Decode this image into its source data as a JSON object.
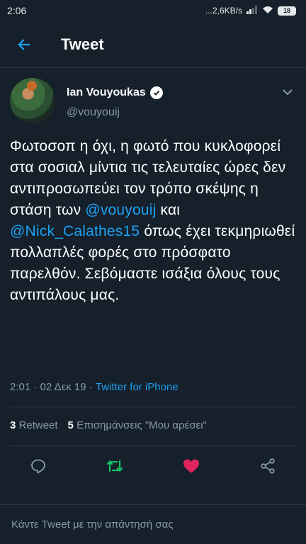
{
  "status_bar": {
    "time": "2:06",
    "network_speed": "...2,6KB/s",
    "battery": "18"
  },
  "header": {
    "title": "Tweet"
  },
  "tweet": {
    "author_name": "Ian Vouyoukas",
    "author_handle": "@vouyouij",
    "text": {
      "p1": "Φωτοσοπ η όχι, η φωτό που κυκλοφορεί στα σοσιαλ μίντια τις τελευταίες ώρες δεν αντιπροσωπεύει τον τρόπο σκέψης η στάση των ",
      "mention1": "@vouyouij",
      "p2": " και ",
      "mention2": "@Nick_Calathes15",
      "p3": " όπως έχει τεκμηριωθεί πολλαπλές φορές στο πρόσφατο παρελθόν. Σεβόμαστε ισάξια όλους τους αντιπάλους μας."
    },
    "timestamp": "2:01 · 02 Δεκ 19 · ",
    "source": "Twitter for iPhone",
    "retweets_count": "3",
    "retweets_label": "Retweet",
    "likes_count": "5",
    "likes_label": "Επισημάνσεις \"Μου αρέσει\""
  },
  "reply": {
    "placeholder": "Κάντε Tweet με την απάντησή σας"
  },
  "colors": {
    "background": "#15202b",
    "accent": "#1da1f2",
    "retweet": "#17bf63",
    "like": "#e0245e",
    "muted": "#8899a6"
  },
  "icons": [
    "back-arrow-icon",
    "verified-badge-icon",
    "chevron-down-icon",
    "reply-icon",
    "retweet-icon",
    "heart-icon",
    "share-icon"
  ]
}
